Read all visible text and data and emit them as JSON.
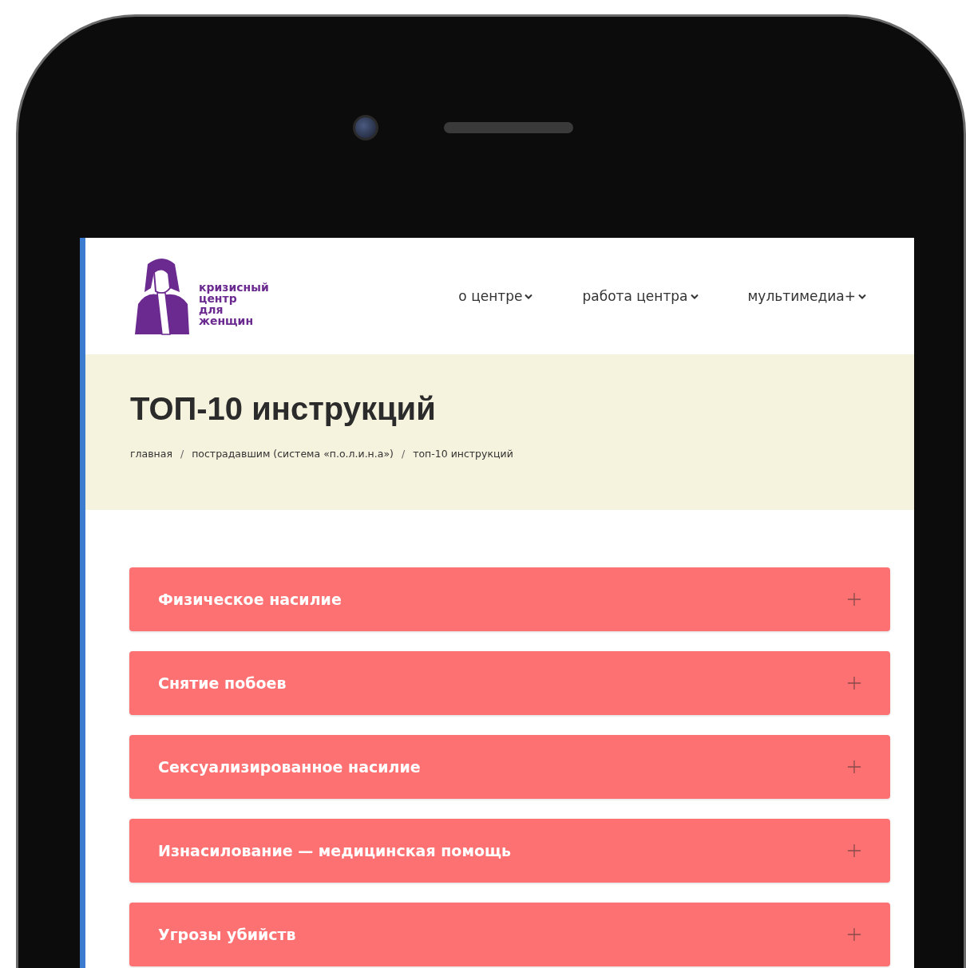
{
  "logo": {
    "lines": [
      "кризисный",
      "центр",
      "для",
      "женщин"
    ]
  },
  "nav": [
    {
      "label": "о центре",
      "dropdown": true
    },
    {
      "label": "работа центра",
      "dropdown": true
    },
    {
      "label": "мультимедиа+",
      "dropdown": true
    }
  ],
  "page_title": "ТОП-10 инструкций",
  "breadcrumb_separator": "/",
  "breadcrumbs": [
    "главная",
    "пострадавшим (система «п.о.л.и.н.а»)",
    "топ-10 инструкций"
  ],
  "accordion": [
    {
      "title": "Физическое насилие",
      "expanded": false
    },
    {
      "title": "Снятие побоев",
      "expanded": false
    },
    {
      "title": "Сексуализированное насилие",
      "expanded": false
    },
    {
      "title": "Изнасилование — медицинская помощь",
      "expanded": false
    },
    {
      "title": "Угрозы убийств",
      "expanded": false
    }
  ]
}
